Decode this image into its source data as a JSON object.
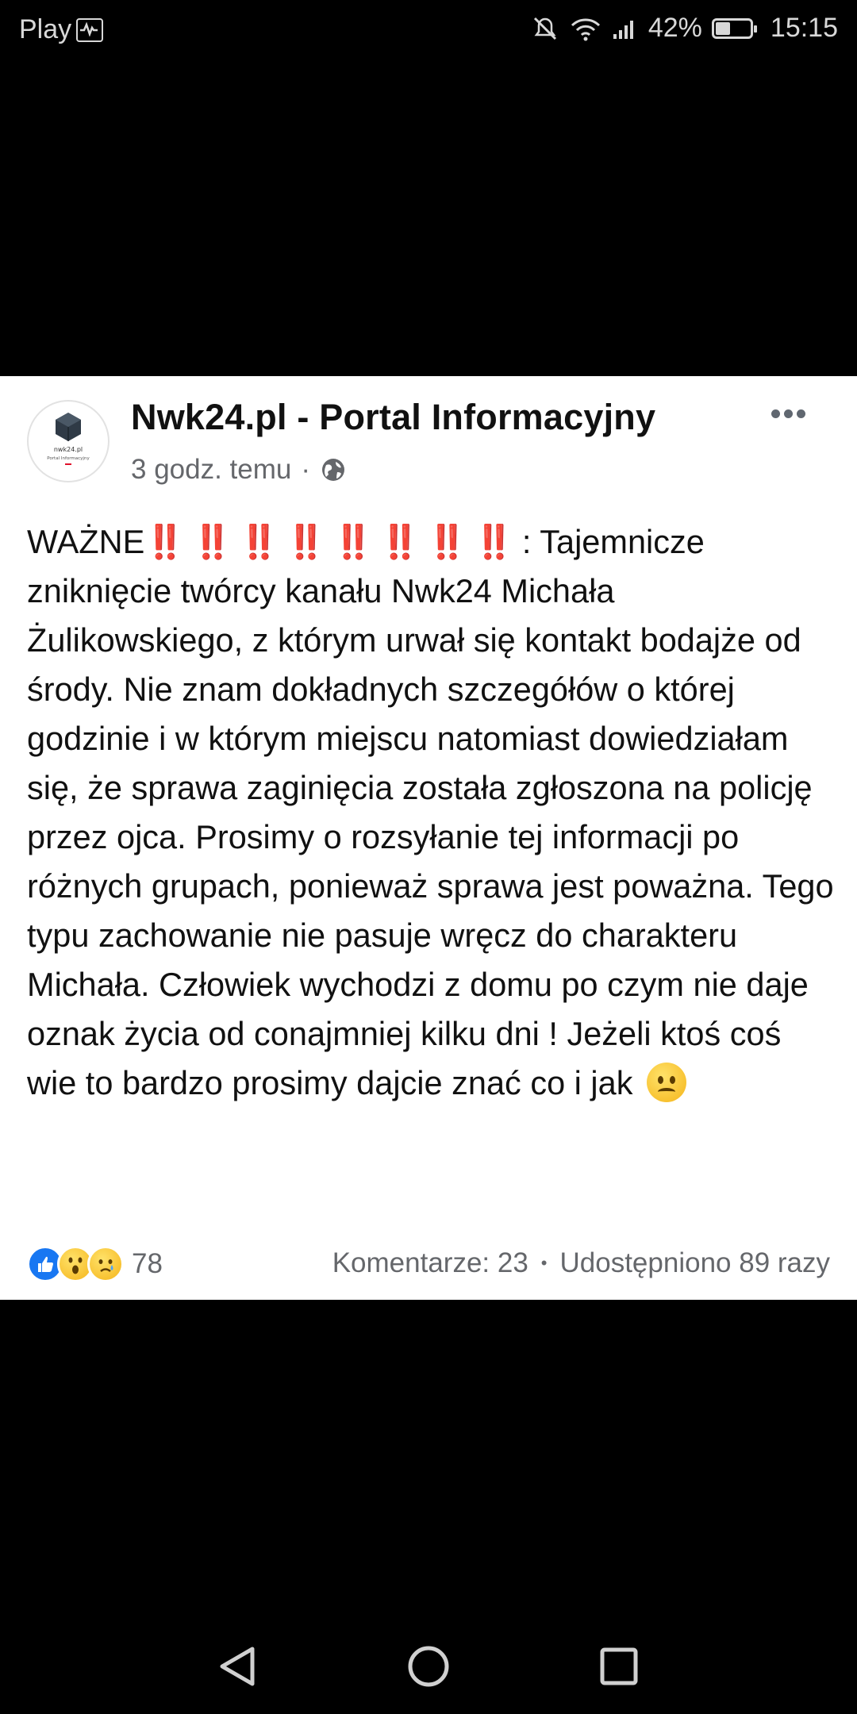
{
  "status_bar": {
    "carrier": "Play",
    "battery": "42%",
    "battery_level": 0.42,
    "time": "15:15",
    "icons": [
      "mute-icon",
      "wifi-icon",
      "signal-icon",
      "battery-icon"
    ]
  },
  "post": {
    "page_name": "Nwk24.pl - Portal Informacyjny",
    "timestamp": "3 godz. temu",
    "separator": "·",
    "avatar_text": [
      "nwk24.pl",
      "Portal Informacyjny"
    ],
    "text_lead": "WAŻNE",
    "exclamations": "‼️ ‼️ ‼️ ‼️ ‼️ ‼️ ‼️ ‼️",
    "text_main": " : Tajemnicze zniknięcie twórcy kanału Nwk24 Michała Żulikowskiego, z którym urwał się kontakt bodajże od środy. Nie znam dokładnych szczegółów o której godzinie i w którym miejscu natomiast dowiedziałam się, że sprawa zaginięcia została zgłoszona na policję przez ojca. Prosimy o rozsyłanie tej informacji po różnych grupach, ponieważ sprawa jest poważna. Tego typu zachowanie nie pasuje wręcz do charakteru Michała. Człowiek wychodzi z domu po czym nie daje oznak życia od conajmniej kilku dni ! Jeżeli ktoś coś wie to bardzo prosimy dajcie znać co i jak",
    "reactions": {
      "types": [
        "like",
        "wow",
        "sad"
      ],
      "count": "78"
    },
    "comments": "Komentarze: 23",
    "dot": "•",
    "shares": "Udostępniono 89 razy"
  },
  "nav": [
    "back-icon",
    "home-icon",
    "recents-icon"
  ],
  "colors": {
    "background": "#000000",
    "card": "#ffffff",
    "exclamation": "#e0112b",
    "like": "#1877f2",
    "secondary_text": "#65676b"
  }
}
